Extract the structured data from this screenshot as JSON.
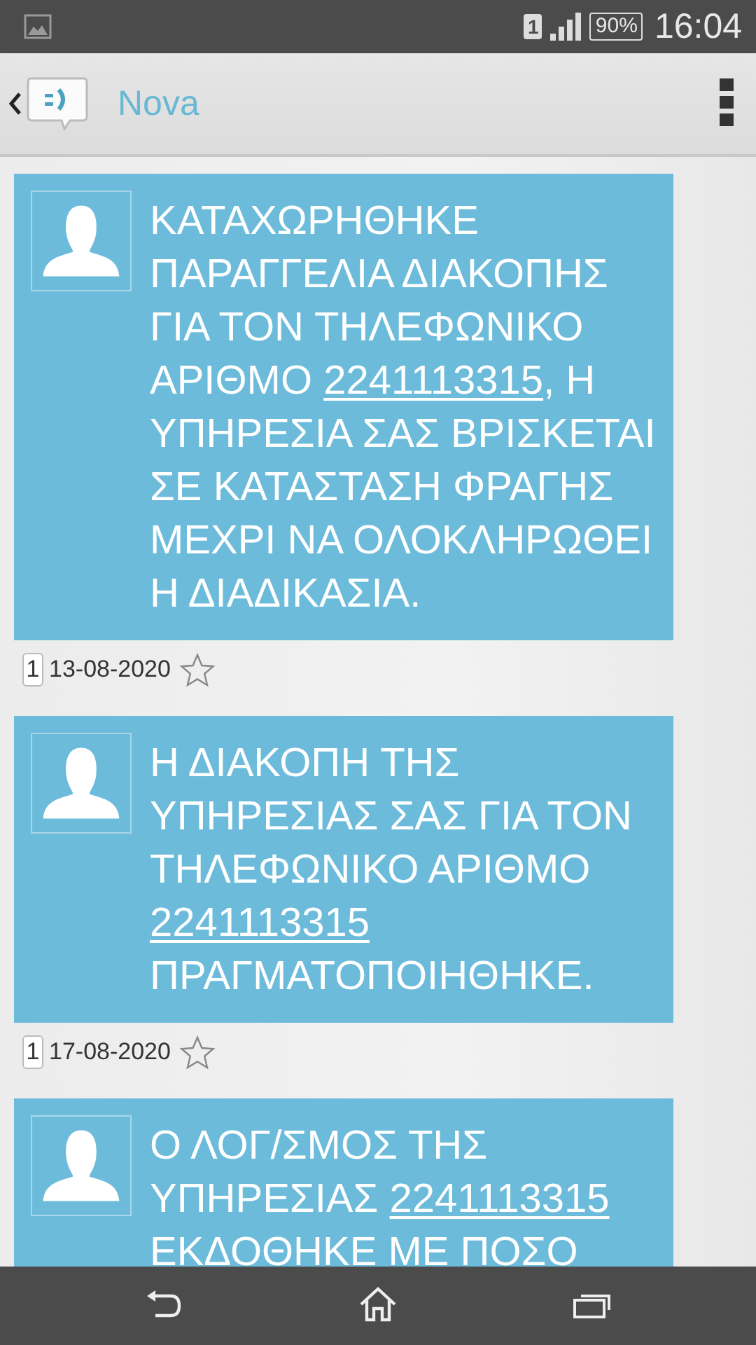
{
  "status_bar": {
    "sim": "1",
    "battery": "90%",
    "time": "16:04"
  },
  "app_bar": {
    "title": "Nova"
  },
  "messages": [
    {
      "parts": [
        {
          "kind": "text",
          "text": "ΚΑΤΑΧΩΡΗΘΗΚΕ ΠΑΡΑΓΓΕΛΙΑ ΔΙΑΚΟΠΗΣ ΓΙΑ ΤΟΝ ΤΗΛΕΦΩΝΙΚΟ ΑΡΙΘΜΟ "
        },
        {
          "kind": "link",
          "text": "2241113315"
        },
        {
          "kind": "text",
          "text": ", Η ΥΠΗΡΕΣΙΑ ΣΑΣ ΒΡΙΣΚΕΤΑΙ ΣΕ ΚΑΤΑΣΤΑΣΗ ΦΡΑΓΗΣ ΜΕΧΡΙ ΝΑ ΟΛΟΚΛΗΡΩΘΕΙ Η ΔΙΑΔΙΚΑΣΙΑ."
        }
      ],
      "sim": "1",
      "date": "13-08-2020",
      "starred": false
    },
    {
      "parts": [
        {
          "kind": "text",
          "text": "Η ΔΙΑΚΟΠΗ ΤΗΣ ΥΠΗΡΕΣΙΑΣ ΣΑΣ ΓΙΑ ΤΟΝ ΤΗΛΕΦΩΝΙΚΟ ΑΡΙΘΜΟ "
        },
        {
          "kind": "link",
          "text": "2241113315"
        },
        {
          "kind": "text",
          "text": " ΠΡΑΓΜΑΤΟΠΟΙΗΘΗΚΕ."
        }
      ],
      "sim": "1",
      "date": "17-08-2020",
      "starred": false
    },
    {
      "parts": [
        {
          "kind": "text",
          "text": "Ο ΛΟΓ/ΣΜΟΣ ΤΗΣ ΥΠΗΡΕΣΙΑΣ "
        },
        {
          "kind": "link",
          "text": "2241113315"
        },
        {
          "kind": "text",
          "text": " ΕΚΔΟΘΗΚΕ ΜΕ ΠΟΣΟ"
        }
      ]
    }
  ]
}
